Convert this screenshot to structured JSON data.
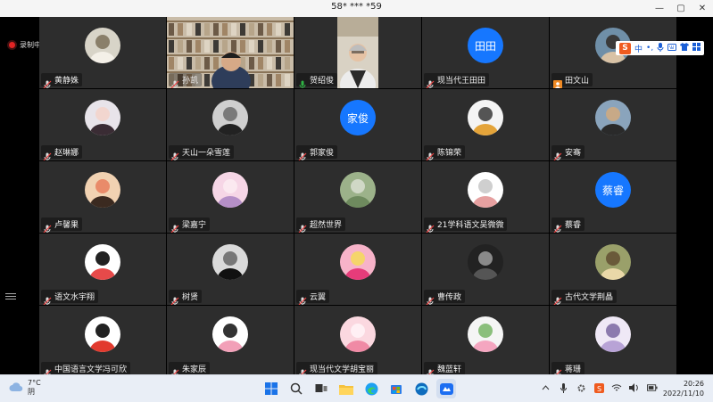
{
  "window": {
    "title": "58* *** *59",
    "controls": [
      "—",
      "▢",
      "✕"
    ]
  },
  "recording": {
    "label": "录制中"
  },
  "ime": {
    "logo": "S",
    "mode": "中",
    "dot": "•,",
    "mic": "mic-icon",
    "keyboard": "keyboard-icon",
    "shirt": "shirt-icon",
    "grid": "grid-icon"
  },
  "participants": [
    {
      "name": "黄静姝",
      "avatar": "photo-dog",
      "mic": "muted"
    },
    {
      "name": "孙凯",
      "avatar": "video-bookshelf",
      "mic": "muted"
    },
    {
      "name": "贺绍俊",
      "avatar": "video-speaker",
      "mic": "speaking",
      "active": true
    },
    {
      "name": "现当代王田田",
      "avatar_text": "田田",
      "avatar_color": "#1677ff",
      "mic": "muted"
    },
    {
      "name": "田文山",
      "avatar": "photo-person",
      "mic": "host"
    },
    {
      "name": "赵琳娜",
      "avatar": "photo-girl",
      "mic": "muted"
    },
    {
      "name": "天山一朵雪莲",
      "avatar": "photo-bw-woman",
      "mic": "muted"
    },
    {
      "name": "郭家俊",
      "avatar_text": "家俊",
      "avatar_color": "#1677ff",
      "mic": "muted"
    },
    {
      "name": "陈锦荣",
      "avatar": "photo-box",
      "mic": "muted"
    },
    {
      "name": "安骞",
      "avatar": "photo-man-outdoor",
      "mic": "muted"
    },
    {
      "name": "卢馨果",
      "avatar": "photo-child",
      "mic": "muted"
    },
    {
      "name": "梁嘉宁",
      "avatar": "photo-anime-pink",
      "mic": "muted"
    },
    {
      "name": "超然世界",
      "avatar": "photo-landscape",
      "mic": "muted"
    },
    {
      "name": "21学科语文吴微微",
      "avatar": "photo-rabbit",
      "mic": "muted"
    },
    {
      "name": "蔡睿",
      "avatar_text": "蔡睿",
      "avatar_color": "#1677ff",
      "mic": "muted"
    },
    {
      "name": "语文水宇翔",
      "avatar": "photo-cartoon-face",
      "mic": "muted"
    },
    {
      "name": "树贤",
      "avatar": "photo-bw-man",
      "mic": "muted"
    },
    {
      "name": "云翼",
      "avatar": "photo-flower",
      "mic": "muted"
    },
    {
      "name": "曹传政",
      "avatar": "photo-dark-figure",
      "mic": "muted"
    },
    {
      "name": "古代文学荆晶",
      "avatar": "photo-duck",
      "mic": "muted"
    },
    {
      "name": "中国语言文学冯可欣",
      "avatar": "photo-shinchan",
      "mic": "muted"
    },
    {
      "name": "朱家辰",
      "avatar": "photo-cartoon-pig",
      "mic": "muted"
    },
    {
      "name": "现当代文学胡宝丽",
      "avatar": "photo-anime-pink2",
      "mic": "muted"
    },
    {
      "name": "魏蓝轩",
      "avatar": "photo-flowers",
      "mic": "muted"
    },
    {
      "name": "蒋珊",
      "avatar": "photo-anime-purple",
      "mic": "muted"
    }
  ],
  "taskbar": {
    "weather_temp": "7°C",
    "weather_text": "阴",
    "apps": [
      "windows-icon",
      "search-icon",
      "file-explorer-icon",
      "edge-icon",
      "store-icon",
      "edge-beta-icon",
      "meeting-icon"
    ],
    "tray": [
      "chevron-up-icon",
      "mic-icon",
      "settings-icon",
      "sogou-icon",
      "wifi-icon",
      "volume-icon",
      "battery-icon"
    ],
    "time": "20:26",
    "date": "2022/11/10"
  },
  "colors": {
    "active": "#2fb344",
    "text_avatar": "#1677ff",
    "tile_bg": "#2d2d2d"
  }
}
